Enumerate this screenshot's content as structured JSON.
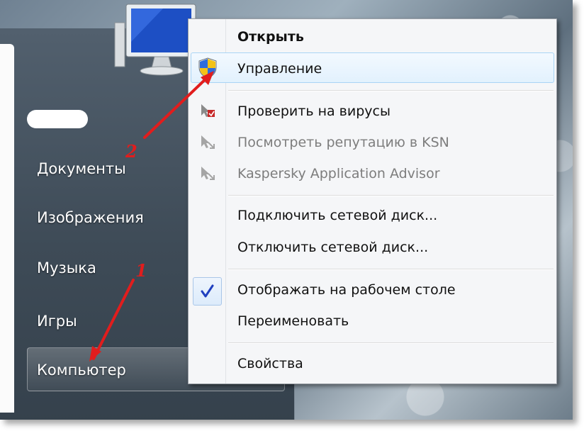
{
  "start_menu": {
    "items": [
      {
        "label": "Документы"
      },
      {
        "label": "Изображения"
      },
      {
        "label": "Музыка"
      },
      {
        "label": "Игры"
      },
      {
        "label": "Компьютер"
      }
    ]
  },
  "context_menu": {
    "items": [
      {
        "label": "Открыть",
        "style": "bold"
      },
      {
        "label": "Управление",
        "icon": "shield-icon",
        "state": "highlighted"
      },
      {
        "label": "Проверить на вирусы",
        "icon": "kaspersky-scan-icon"
      },
      {
        "label": "Посмотреть репутацию в KSN",
        "icon": "kaspersky-icon",
        "state": "disabled"
      },
      {
        "label": "Kaspersky Application Advisor",
        "icon": "kaspersky-icon",
        "state": "disabled"
      },
      {
        "label": "Подключить сетевой диск..."
      },
      {
        "label": "Отключить сетевой диск..."
      },
      {
        "label": "Отображать на рабочем столе",
        "icon": "checkmark-icon",
        "checked": true
      },
      {
        "label": "Переименовать"
      },
      {
        "label": "Свойства"
      }
    ]
  },
  "annotations": [
    {
      "number": "1",
      "points_to": "Компьютер"
    },
    {
      "number": "2",
      "points_to": "Управление"
    }
  ],
  "colors": {
    "annotation": "#e11d1d",
    "highlight_border": "#a9d4f5",
    "checkmark": "#1f3fbf"
  }
}
